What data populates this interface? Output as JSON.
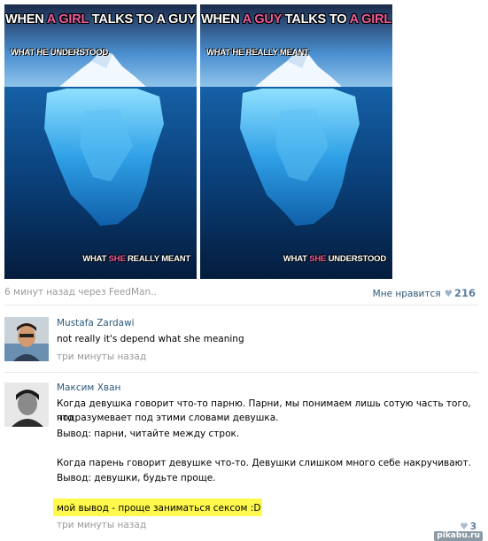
{
  "post": {
    "meme_left": {
      "title_pre": "WHEN ",
      "title_pink": "A GIRL",
      "title_post": " TALKS TO A GUY",
      "top_caption": "WHAT HE UNDERSTOOD",
      "bottom_pre": "WHAT ",
      "bottom_pink": "SHE",
      "bottom_post": " REALLY MEANT"
    },
    "meme_right": {
      "title_pre": "WHEN ",
      "title_pink": "A GUY",
      "title_post": " TALKS TO ",
      "title_pink2": "A GIRL",
      "top_caption": "WHAT HE REALLY MEANT",
      "bottom_pre": "WHAT ",
      "bottom_pink": "SHE",
      "bottom_post": " UNDERSTOOD"
    },
    "meta": "6 минут назад через FeedMan..",
    "like_label": "Мне нравится",
    "like_count": "216"
  },
  "comments": [
    {
      "author": "Mustafa Zardawi",
      "lines": [
        "not really it's depend what she meaning"
      ],
      "time": "три минуты назад"
    },
    {
      "author": "Максим Хван",
      "lines": [
        "Когда девушка говорит что-то парню. Парни, мы понимаем лишь сотую часть того, что",
        "подразумевает под этими словами девушка.",
        "Вывод: парни, читайте между строк.",
        "",
        "Когда парень говорит девушке что-то. Девушки слишком много себе накручивают.",
        "Вывод: девушки, будьте проще.",
        "",
        "мой вывод - проще заниматься сексом :D"
      ],
      "time": "три минуты назад",
      "like_count": "3"
    }
  ],
  "watermark": "pikabu.ru",
  "colors": {
    "link": "#2b587a",
    "highlight": "#fff94d",
    "pink": "#ec5d9a"
  }
}
